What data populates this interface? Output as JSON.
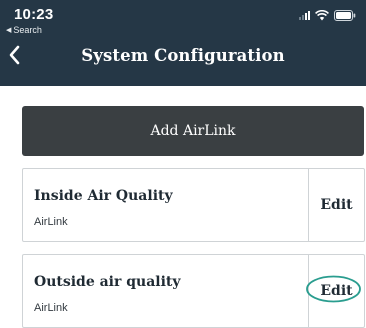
{
  "status_bar": {
    "time": "10:23",
    "back_app": "Search"
  },
  "nav": {
    "title": "System Configuration"
  },
  "add_button": {
    "label": "Add AirLink"
  },
  "devices": [
    {
      "name": "Inside Air Quality",
      "type": "AirLink",
      "edit_label": "Edit"
    },
    {
      "name": "Outside air quality",
      "type": "AirLink",
      "edit_label": "Edit"
    }
  ],
  "colors": {
    "header_bg": "#253746",
    "button_bg": "#3a3f42",
    "highlight": "#2a9d8f"
  }
}
